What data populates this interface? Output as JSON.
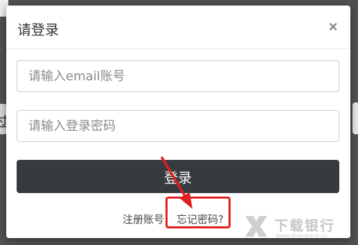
{
  "modal": {
    "title": "请登录",
    "close_label": "×"
  },
  "form": {
    "email_placeholder": "请输入email账号",
    "password_placeholder": "请输入登录密码",
    "login_label": "登录"
  },
  "links": {
    "register": "注册账号",
    "forgot": "忘记密码?"
  },
  "background": {
    "left_fragment_text": "过"
  },
  "watermark": {
    "text": "下载银行",
    "domain": "www.downbank.cn"
  },
  "colors": {
    "highlight": "#e21f1f",
    "button": "#373a3e"
  }
}
